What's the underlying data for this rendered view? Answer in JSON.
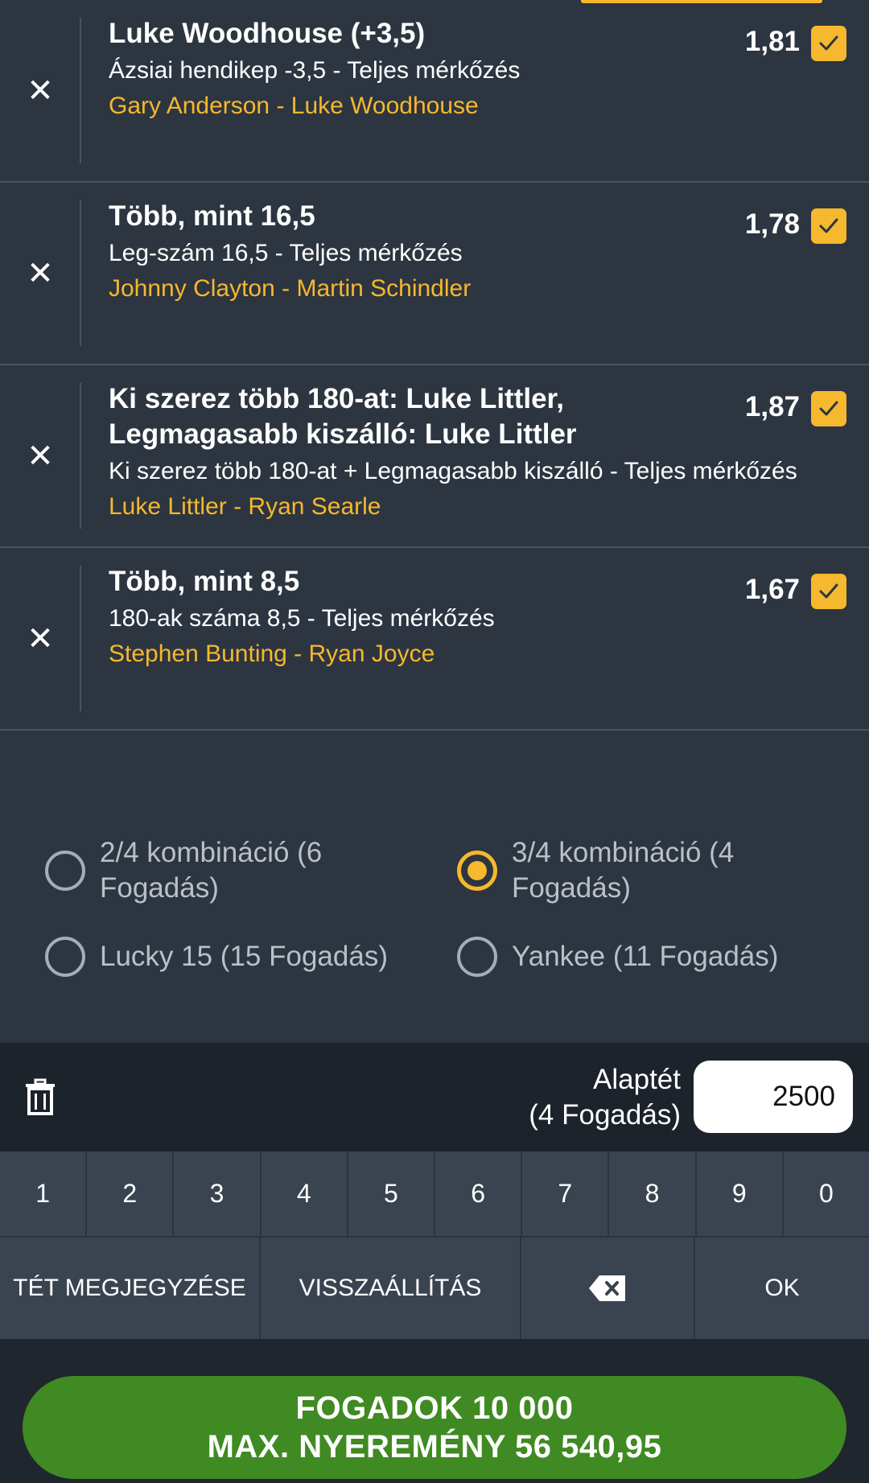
{
  "selections": [
    {
      "title": "Luke Woodhouse (+3,5)",
      "market": "Ázsiai hendikep -3,5 - Teljes mérkőzés",
      "event": "Gary Anderson - Luke Woodhouse",
      "odds": "1,81"
    },
    {
      "title": "Több, mint 16,5",
      "market": "Leg-szám 16,5 - Teljes mérkőzés",
      "event": "Johnny Clayton - Martin Schindler",
      "odds": "1,78"
    },
    {
      "title": "Ki szerez több 180-at: Luke Littler, Legmagasabb kiszálló: Luke Littler",
      "market": "Ki szerez több 180-at + Legmagasabb kiszálló - Teljes mérkőzés",
      "event": "Luke Littler - Ryan Searle",
      "odds": "1,87"
    },
    {
      "title": "Több, mint 8,5",
      "market": "180-ak száma 8,5 - Teljes mérkőzés",
      "event": "Stephen Bunting - Ryan Joyce",
      "odds": "1,67"
    }
  ],
  "bet_types": [
    {
      "label": "2/4 kombináció (6 Fogadás)",
      "selected": false
    },
    {
      "label": "3/4 kombináció (4 Fogadás)",
      "selected": true
    },
    {
      "label": "Lucky 15 (15 Fogadás)",
      "selected": false
    },
    {
      "label": "Yankee (11 Fogadás)",
      "selected": false
    }
  ],
  "stake": {
    "label_line1": "Alaptét",
    "label_line2": "(4 Fogadás)",
    "value": "2500"
  },
  "keypad": {
    "digits": [
      "1",
      "2",
      "3",
      "4",
      "5",
      "6",
      "7",
      "8",
      "9",
      "0"
    ],
    "remember_label": "TÉT MEGJEGYZÉSE",
    "reset_label": "VISSZAÁLLÍTÁS",
    "ok_label": "OK"
  },
  "place_bet": {
    "line1": "FOGADOK  10 000",
    "line2": "MAX. NYEREMÉNY 56 540,95"
  },
  "colors": {
    "accent": "#f5b82e",
    "background": "#2d3540",
    "button_green": "#3f8a22"
  }
}
